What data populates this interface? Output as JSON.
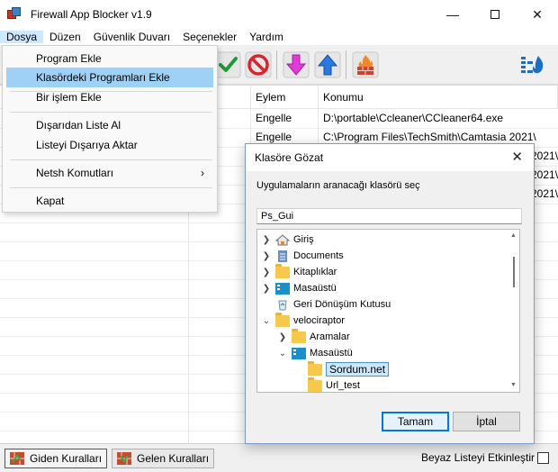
{
  "window": {
    "title": "Firewall App Blocker v1.9"
  },
  "menubar": [
    "Dosya",
    "Düzen",
    "Güvenlik Duvarı",
    "Seçenekler",
    "Yardım"
  ],
  "dropdown": {
    "items": [
      {
        "label": "Program Ekle"
      },
      {
        "label": "Klasördeki Programları Ekle",
        "selected": true
      },
      {
        "label": "Bir işlem Ekle"
      },
      {
        "label": "Dışarıdan Liste Al"
      },
      {
        "label": "Listeyi Dışarıya Aktar"
      },
      {
        "label": "Netsh Komutları",
        "submenu": true
      },
      {
        "label": "Kapat"
      }
    ]
  },
  "toolbar": {
    "icons": [
      "check-icon",
      "block-icon",
      "move-down-icon",
      "move-up-icon",
      "firewall-icon",
      "firewall-settings-icon"
    ]
  },
  "list": {
    "headers": [
      "Eylem",
      "Konumu"
    ],
    "rows": [
      {
        "action": "Engelle",
        "path": "D:\\portable\\Ccleaner\\CCleaner64.exe"
      },
      {
        "action": "Engelle",
        "path": "C:\\Program Files\\TechSmith\\Camtasia 2021\\"
      },
      {
        "action": "",
        "path": "2021\\"
      },
      {
        "action": "",
        "path": "2021\\"
      },
      {
        "action": "",
        "path": "2021\\"
      }
    ]
  },
  "statusbar": {
    "tab_outgoing": "Giden Kuralları",
    "tab_incoming": "Gelen Kuralları",
    "whitelist_label": "Beyaz Listeyi Etkinleştir"
  },
  "dialog": {
    "title": "Klasöre Gözat",
    "description": "Uygulamaların aranacağı klasörü seç",
    "folder_input": "Ps_Gui",
    "tree": [
      {
        "label": "Giriş",
        "icon": "home-icon",
        "expander": ">"
      },
      {
        "label": "Documents",
        "icon": "documents-icon",
        "expander": ">"
      },
      {
        "label": "Kitaplıklar",
        "icon": "folder-icon",
        "expander": ">"
      },
      {
        "label": "Masaüstü",
        "icon": "desktop-icon",
        "expander": ">"
      },
      {
        "label": "Geri Dönüşüm Kutusu",
        "icon": "recycle-bin-icon",
        "expander": ""
      },
      {
        "label": "velociraptor",
        "icon": "folder-icon",
        "expander": "v"
      },
      {
        "label": "Aramalar",
        "icon": "folder-icon",
        "expander": ">"
      },
      {
        "label": "Masaüstü",
        "icon": "desktop-icon",
        "expander": "v"
      },
      {
        "label": "Sordum.net",
        "icon": "folder-icon",
        "expander": "",
        "selected": true
      },
      {
        "label": "Url_test",
        "icon": "folder-icon",
        "expander": ""
      }
    ],
    "ok_label": "Tamam",
    "cancel_label": "İptal"
  },
  "colors": {
    "selection": "#9fd0f6",
    "dialog_default_border": "#0078d7"
  }
}
